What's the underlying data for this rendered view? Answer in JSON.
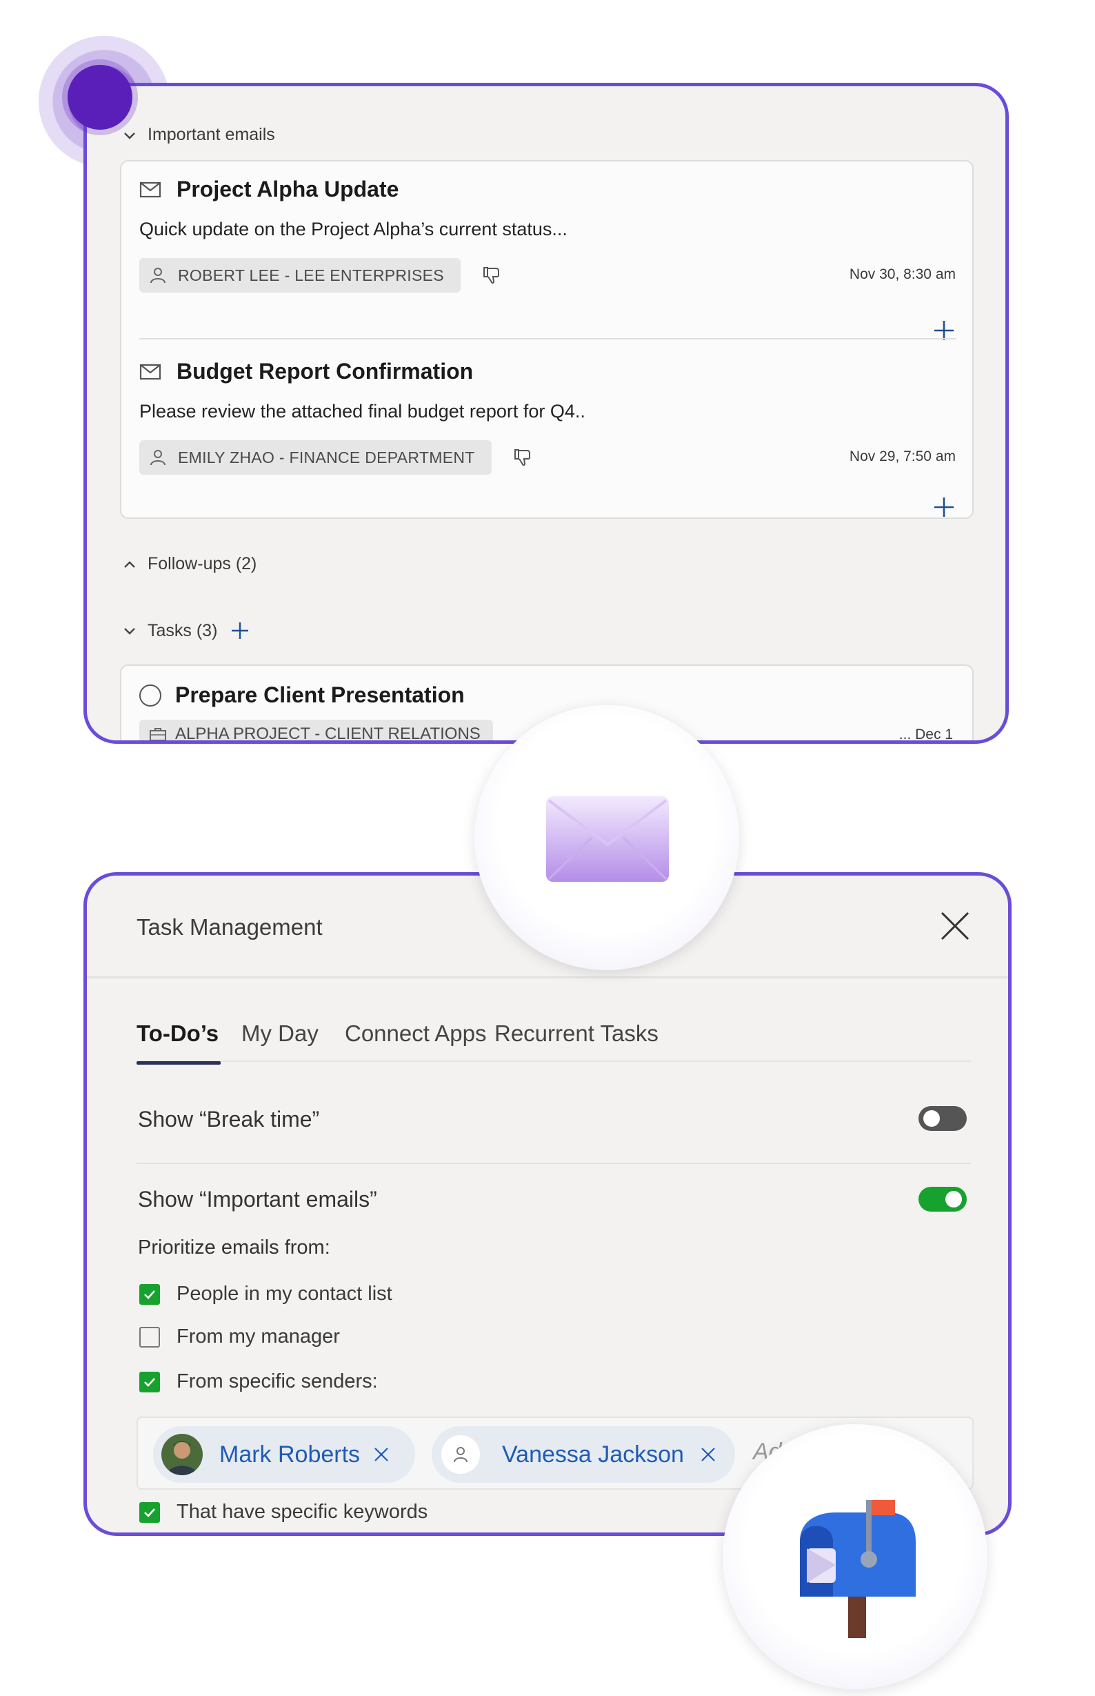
{
  "top_card": {
    "important_emails_label": "Important emails",
    "emails": [
      {
        "subject": "Project Alpha Update",
        "snippet": "Quick update on the Project Alpha’s current status...",
        "sender": "ROBERT LEE - LEE ENTERPRISES",
        "date": "Nov 30, 8:30 am"
      },
      {
        "subject": "Budget Report Confirmation",
        "snippet": "Please review the attached final budget report for Q4..",
        "sender": "EMILY ZHAO - FINANCE DEPARTMENT",
        "date": "Nov 29, 7:50 am"
      }
    ],
    "followups_label": "Follow-ups (2)",
    "tasks_label": "Tasks (3)",
    "task": {
      "title": "Prepare Client Presentation",
      "project": "ALPHA PROJECT - CLIENT RELATIONS",
      "date": "... Dec 1"
    }
  },
  "panel": {
    "title": "Task Management",
    "tabs": [
      "To-Do’s",
      "My Day",
      "Connect Apps",
      "Recurrent Tasks"
    ],
    "active_tab": "To-Do’s",
    "break_time_label": "Show “Break time”",
    "break_time_on": false,
    "important_emails_label": "Show “Important emails”",
    "important_emails_on": true,
    "prioritize_label": "Prioritize emails from:",
    "options": [
      {
        "label": "People in my contact list",
        "checked": true
      },
      {
        "label": "From my manager",
        "checked": false
      },
      {
        "label": "From specific senders:",
        "checked": true
      },
      {
        "label": "That have specific keywords",
        "checked": true
      }
    ],
    "senders": [
      "Mark Roberts",
      "Vanessa Jackson"
    ],
    "add_placeholder": "Ad"
  },
  "colors": {
    "card_border": "#6a4cd9",
    "toggle_on": "#17a22f",
    "link_blue": "#1f5bb5",
    "tab_underline": "#2b2f5c"
  },
  "icons": [
    "mail-icon",
    "person-icon",
    "thumbs-down-icon",
    "plus-icon",
    "chevron-down-icon",
    "chevron-up-icon",
    "briefcase-icon",
    "close-icon",
    "check-icon",
    "envelope-3d-icon",
    "mailbox-3d-icon"
  ]
}
